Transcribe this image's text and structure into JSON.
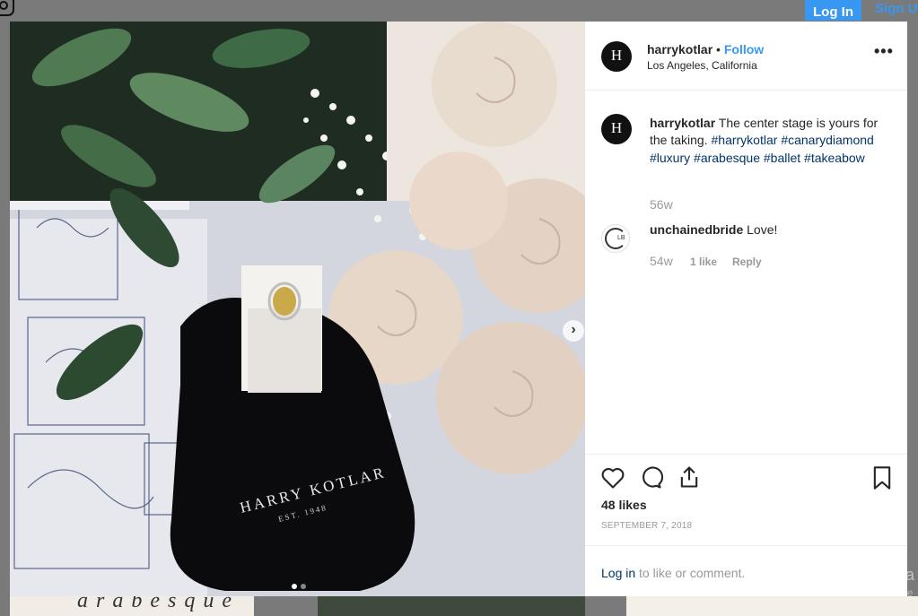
{
  "topbar": {
    "login_label": "Log In",
    "signup_label": "Sign Up",
    "logo_icon": "instagram-icon"
  },
  "photo": {
    "pouch_brand": "HARRY KOTLAR",
    "pouch_est": "EST. 1948",
    "next_icon": "chevron-right-icon",
    "slide_count": 2,
    "active_slide": 1
  },
  "post": {
    "avatar_letter": "H",
    "username": "harrykotlar",
    "separator": "•",
    "follow_label": "Follow",
    "location": "Los Angeles, California",
    "more_icon": "more-options-icon",
    "more_label": "•••"
  },
  "caption": {
    "username": "harrykotlar",
    "text": "The center stage is yours for the taking.",
    "hashtags": [
      "#harrykotlar",
      "#canarydiamond",
      "#luxury",
      "#arabesque",
      "#ballet",
      "#takeabow"
    ],
    "time": "56w"
  },
  "comments": [
    {
      "username": "unchainedbride",
      "avatar_initials": "LB",
      "text": "Love!",
      "time": "54w",
      "likes": "1 like",
      "reply_label": "Reply"
    }
  ],
  "actions": {
    "like_icon": "heart-icon",
    "comment_icon": "comment-icon",
    "share_icon": "share-icon",
    "save_icon": "bookmark-icon",
    "likes": "48 likes",
    "date": "SEPTEMBER 7, 2018"
  },
  "login_prompt": {
    "link": "Log in",
    "rest": " to like or comment."
  },
  "watermark": {
    "line1": "Activa",
    "line2": "Go to Se"
  },
  "below_strip": {
    "text": "arabesque"
  },
  "colors": {
    "accent": "#3897f0",
    "hashtag": "#003569",
    "muted": "#999999",
    "text": "#262626"
  }
}
